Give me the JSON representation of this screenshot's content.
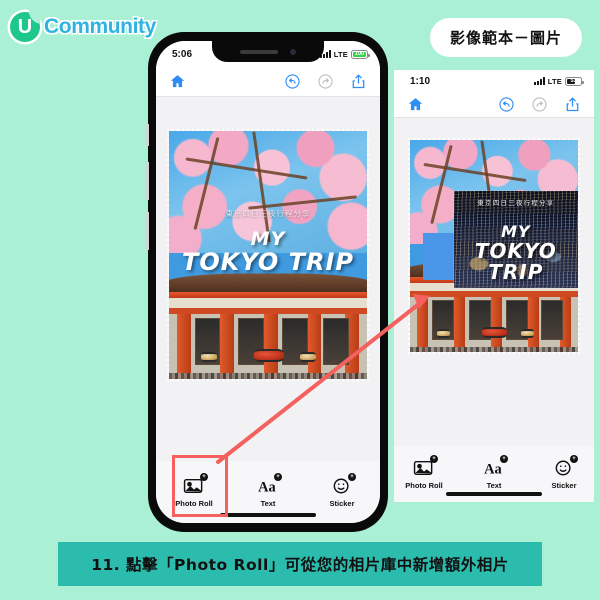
{
  "brand": {
    "logo_letter": "U",
    "logo_text": "Community"
  },
  "badge": {
    "label": "影像範本－圖片"
  },
  "caption": {
    "text": "11. 點擊「Photo Roll」可從您的相片庫中新增額外相片"
  },
  "colors": {
    "background": "#aaf0d5",
    "caption_bar": "#2cbcae",
    "brand_green": "#1ec88c",
    "brand_blue": "#2fb3e0",
    "highlight_red": "#f4615f",
    "toolbar_active": "#2f8ef4"
  },
  "left_phone": {
    "status": {
      "time": "5:06",
      "network": "LTE",
      "battery_text": "100"
    },
    "toolbar": {
      "home": "home-icon",
      "undo": "undo-icon",
      "redo": "redo-icon",
      "share": "share-icon"
    },
    "canvas": {
      "handwriting": "東京四日三夜行程分享",
      "title_line1": "MY",
      "title_line2": "TOKYO TRIP"
    },
    "bottom_tools": [
      {
        "label": "Photo Roll",
        "icon": "photo-roll-icon",
        "badge": "+",
        "highlighted": true
      },
      {
        "label": "Text",
        "icon": "text-icon",
        "badge": "+",
        "highlighted": false
      },
      {
        "label": "Sticker",
        "icon": "sticker-icon",
        "badge": "+",
        "highlighted": false
      }
    ]
  },
  "right_panel": {
    "status": {
      "time": "1:10",
      "network": "LTE",
      "battery_text": "53"
    },
    "toolbar": {
      "home": "home-icon",
      "undo": "undo-icon",
      "redo": "redo-icon",
      "share": "share-icon"
    },
    "canvas": {
      "handwriting": "東京四日三夜行程分享",
      "title_line1": "MY",
      "title_line2": "TOKYO TRIP"
    },
    "inserted_photo": {
      "handwriting": "東京四日三夜行程分享",
      "title_line1": "MY",
      "title_line2": "TOKYO TRIP"
    },
    "bottom_tools": [
      {
        "label": "Photo Roll",
        "icon": "photo-roll-icon",
        "badge": "+",
        "highlighted": false
      },
      {
        "label": "Text",
        "icon": "text-icon",
        "badge": "+",
        "highlighted": false
      },
      {
        "label": "Sticker",
        "icon": "sticker-icon",
        "badge": "+",
        "highlighted": false
      }
    ]
  }
}
